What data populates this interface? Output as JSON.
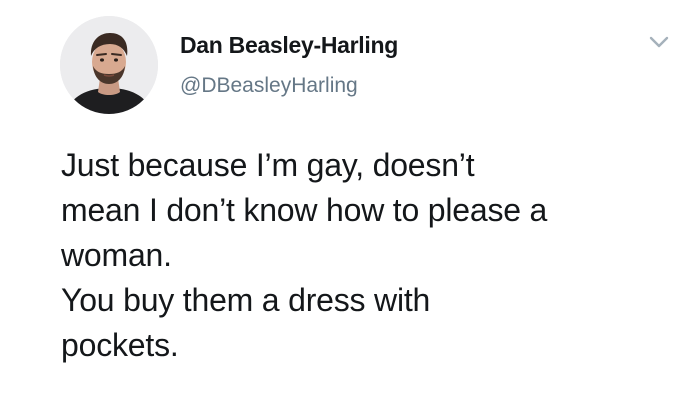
{
  "tweet": {
    "author": {
      "display_name": "Dan Beasley-Harling",
      "handle": "@DBeasleyHarling",
      "avatar_icon": "profile-photo"
    },
    "menu_icon": "chevron-down-icon",
    "text_lines": [
      "Just because I’m gay, doesn’t",
      "mean I don’t know how to please a",
      "woman.",
      "You buy them a dress with",
      "pockets."
    ]
  },
  "colors": {
    "text": "#14171a",
    "secondary_text": "#657786",
    "background": "#ffffff",
    "chevron": "#a5b1bb"
  }
}
